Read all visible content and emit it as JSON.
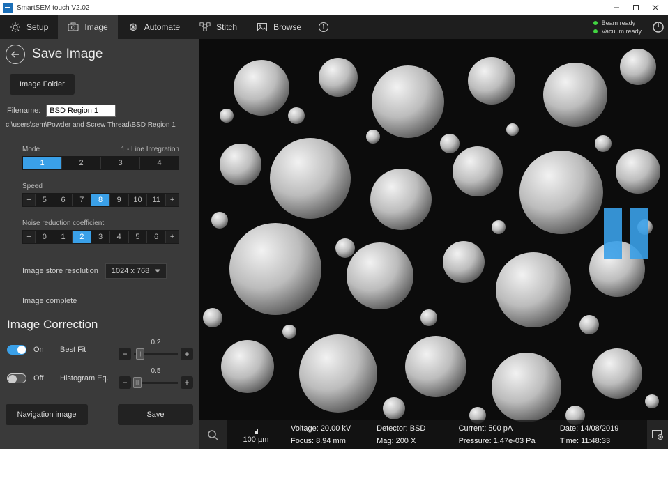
{
  "window": {
    "title": "SmartSEM touch V2.02"
  },
  "toolbar": {
    "setup": "Setup",
    "image": "Image",
    "automate": "Automate",
    "stitch": "Stitch",
    "browse": "Browse"
  },
  "status": {
    "beam": "Beam ready",
    "vacuum": "Vacuum ready"
  },
  "panel": {
    "title": "Save Image",
    "image_folder_btn": "Image Folder",
    "filename_label": "Filename:",
    "filename_value": "BSD Region 1",
    "path": "c:\\users\\sem\\Powder and Screw Thread\\BSD Region 1",
    "mode": {
      "label": "Mode",
      "current_name": "1 - Line Integration",
      "options": [
        "1",
        "2",
        "3",
        "4"
      ],
      "selected": "1"
    },
    "speed": {
      "label": "Speed",
      "options": [
        "5",
        "6",
        "7",
        "8",
        "9",
        "10",
        "11"
      ],
      "selected": "8"
    },
    "noise": {
      "label": "Noise reduction coefficient",
      "options": [
        "0",
        "1",
        "2",
        "3",
        "4",
        "5",
        "6"
      ],
      "selected": "2"
    },
    "resolution_label": "Image store resolution",
    "resolution_value": "1024 x 768",
    "complete": "Image complete",
    "correction_title": "Image Correction",
    "bestfit": {
      "state": "On",
      "name": "Best Fit",
      "value": "0.2"
    },
    "histeq": {
      "state": "Off",
      "name": "Histogram Eq.",
      "value": "0.5"
    },
    "nav_btn": "Navigation image",
    "save_btn": "Save",
    "minus": "−",
    "plus": "+"
  },
  "viewer": {
    "scale_label": "100 µm",
    "info": {
      "voltage": "Voltage: 20.00 kV",
      "focus": "Focus: 8.94 mm",
      "detector": "Detector: BSD",
      "mag": "Mag: 200 X",
      "current": "Current: 500 pA",
      "pressure": "Pressure: 1.47e-03 Pa",
      "date": "Date: 14/08/2019",
      "time": "Time: 11:48:33"
    }
  }
}
